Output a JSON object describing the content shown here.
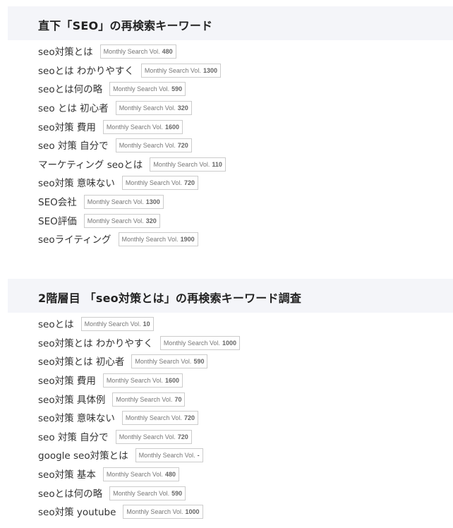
{
  "badge_label": "Monthly Search Vol.",
  "sections": [
    {
      "title": "直下「SEO」の再検索キーワード",
      "keywords": [
        {
          "text": "seo対策とは",
          "volume": "480"
        },
        {
          "text": "seoとは わかりやすく",
          "volume": "1300"
        },
        {
          "text": "seoとは何の略",
          "volume": "590"
        },
        {
          "text": "seo とは 初心者",
          "volume": "320"
        },
        {
          "text": "seo対策 費用",
          "volume": "1600"
        },
        {
          "text": "seo 対策 自分で",
          "volume": "720"
        },
        {
          "text": "マーケティング seoとは",
          "volume": "110"
        },
        {
          "text": "seo対策 意味ない",
          "volume": "720"
        },
        {
          "text": "SEO会社",
          "volume": "1300"
        },
        {
          "text": "SEO評価",
          "volume": "320"
        },
        {
          "text": "seoライティング",
          "volume": "1900"
        }
      ]
    },
    {
      "title": "2階層目 「seo対策とは」の再検索キーワード調査",
      "keywords": [
        {
          "text": "seoとは",
          "volume": "10"
        },
        {
          "text": "seo対策とは わかりやすく",
          "volume": "1000"
        },
        {
          "text": "seo対策とは 初心者",
          "volume": "590"
        },
        {
          "text": "seo対策 費用",
          "volume": "1600"
        },
        {
          "text": "seo対策 具体例",
          "volume": "70"
        },
        {
          "text": "seo対策 意味ない",
          "volume": "720"
        },
        {
          "text": "seo 対策 自分で",
          "volume": "720"
        },
        {
          "text": "google seo対策とは",
          "volume": "-"
        },
        {
          "text": "seo対策 基本",
          "volume": "480"
        },
        {
          "text": "seoとは何の略",
          "volume": "590"
        },
        {
          "text": "seo対策 youtube",
          "volume": "1000"
        }
      ]
    }
  ]
}
